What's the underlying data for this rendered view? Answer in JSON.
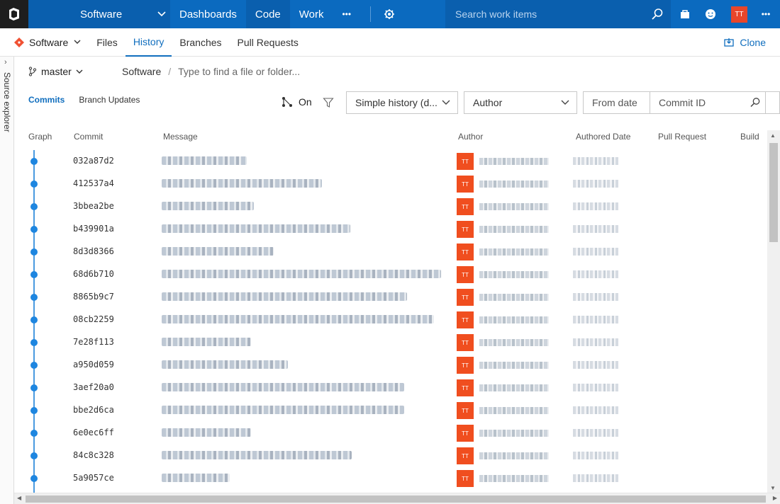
{
  "topbar": {
    "project": "Software",
    "hubs": [
      "Dashboards",
      "Code",
      "Work"
    ],
    "more": "•••",
    "search_placeholder": "Search work items",
    "user_initials": "TT",
    "overflow": "•••"
  },
  "subnav": {
    "repo": "Software",
    "tabs": [
      "Files",
      "History",
      "Branches",
      "Pull Requests"
    ],
    "active_tab": "History",
    "clone": "Clone"
  },
  "rail": {
    "label": "Source explorer"
  },
  "path": {
    "branch": "master",
    "root": "Software",
    "separator": "/",
    "placeholder": "Type to find a file or folder..."
  },
  "toolbar": {
    "pivots": [
      "Commits",
      "Branch Updates"
    ],
    "graph_toggle": "On",
    "history_mode": "Simple history (d...",
    "author": "Author",
    "from_date": "From date",
    "commit_id": "Commit ID"
  },
  "table": {
    "columns": [
      "Graph",
      "Commit",
      "Message",
      "Author",
      "Authored Date",
      "Pull Request",
      "Build"
    ],
    "rows": [
      {
        "commit": "032a87d2",
        "initials": "TT"
      },
      {
        "commit": "412537a4",
        "initials": "TT"
      },
      {
        "commit": "3bbea2be",
        "initials": "TT"
      },
      {
        "commit": "b439901a",
        "initials": "TT"
      },
      {
        "commit": "8d3d8366",
        "initials": "TT"
      },
      {
        "commit": "68d6b710",
        "initials": "TT"
      },
      {
        "commit": "8865b9c7",
        "initials": "TT"
      },
      {
        "commit": "08cb2259",
        "initials": "TT"
      },
      {
        "commit": "7e28f113",
        "initials": "TT"
      },
      {
        "commit": "a950d059",
        "initials": "TT"
      },
      {
        "commit": "3aef20a0",
        "initials": "TT"
      },
      {
        "commit": "bbe2d6ca",
        "initials": "TT"
      },
      {
        "commit": "6e0ec6ff",
        "initials": "TT"
      },
      {
        "commit": "84c8c328",
        "initials": "TT"
      },
      {
        "commit": "5a9057ce",
        "initials": "TT"
      }
    ]
  },
  "colors": {
    "brand": "#0b6abf",
    "accent": "#106ebe",
    "avatar": "#f04e1f",
    "graph": "#1e86e0"
  }
}
